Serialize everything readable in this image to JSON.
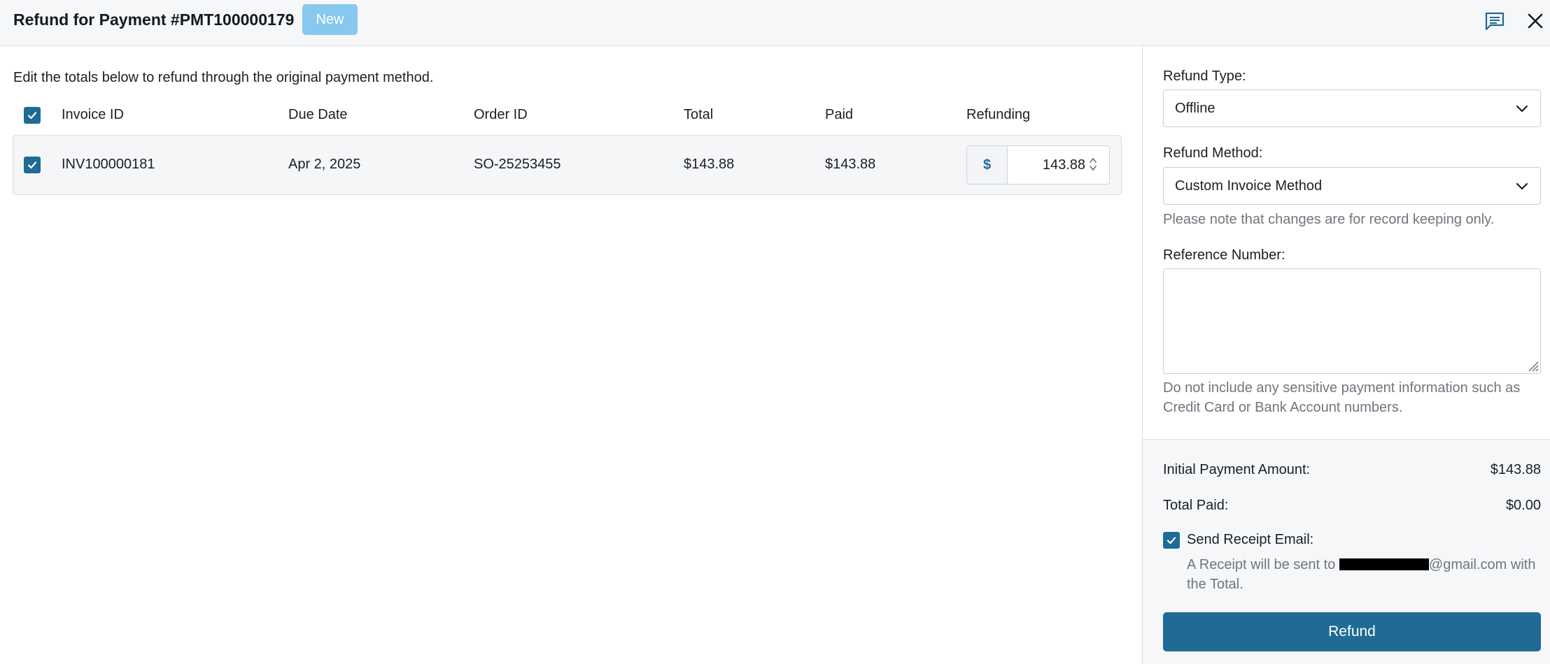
{
  "header": {
    "title": "Refund for Payment #PMT100000179",
    "status_badge": "New",
    "icons": [
      "comments-icon",
      "close-icon"
    ]
  },
  "main": {
    "intro_text": "Edit the totals below to refund through the original payment method.",
    "columns": [
      "Invoice ID",
      "Due Date",
      "Order ID",
      "Total",
      "Paid",
      "Refunding"
    ],
    "select_all_checked": true,
    "rows": [
      {
        "checked": true,
        "invoice_id": "INV100000181",
        "due_date": "Apr 2, 2025",
        "order_id": "SO-25253455",
        "total": "$143.88",
        "paid": "$143.88",
        "currency_symbol": "$",
        "refunding": "143.88"
      }
    ]
  },
  "sidebar": {
    "refund_type_label": "Refund Type:",
    "refund_type_value": "Offline",
    "refund_method_label": "Refund Method:",
    "refund_method_value": "Custom Invoice Method",
    "record_note": "Please note that changes are for record keeping only.",
    "reference_label": "Reference Number:",
    "reference_value": "",
    "sensitive_note": "Do not include any sensitive payment information such as Credit Card or Bank Account numbers.",
    "initial_payment_label": "Initial Payment Amount:",
    "initial_payment_value": "$143.88",
    "total_paid_label": "Total Paid:",
    "total_paid_value": "$0.00",
    "send_receipt_label": "Send Receipt Email:",
    "send_receipt_checked": true,
    "receipt_note_prefix": "A Receipt will be sent to",
    "receipt_note_email_suffix": "@gmail.com with the Total.",
    "refund_button": "Refund"
  },
  "colors": {
    "accent": "#1f6b94",
    "badge": "#87c8ef",
    "header_bg": "#f6f7f9",
    "muted_text": "#6f767e"
  }
}
